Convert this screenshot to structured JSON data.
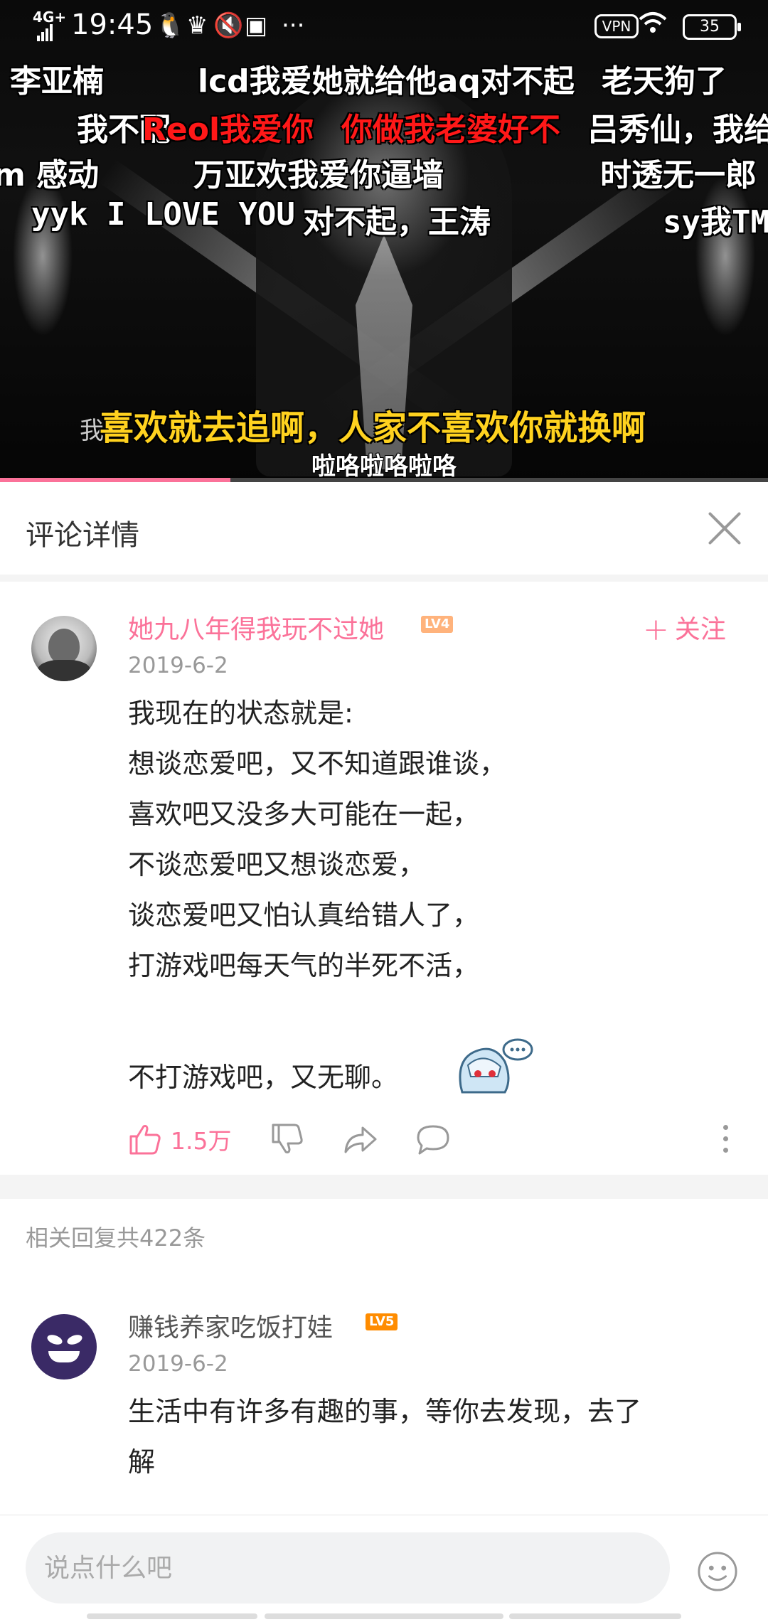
{
  "status_bar": {
    "signal": "4G+",
    "time": "19:45",
    "vpn_label": "VPN",
    "battery": "35"
  },
  "video": {
    "danmaku": {
      "d1": "李亚楠",
      "d2": "lcd我爱她就给他aq对不起",
      "d3": "老天狗了",
      "d4": "我不配",
      "d5": "Reol我爱你",
      "d6": "你做我老婆好不",
      "d7": "吕秀仙，我给",
      "d8": "m 感动",
      "d9": "万亚欢我爱你逼墙",
      "d10": "时透无一郎",
      "d11": "yyk I LOVE YOU",
      "d12": "对不起，王涛",
      "d13": "sy我TM"
    },
    "subtitle_main": "喜欢就去追啊，人家不喜欢你就换啊",
    "subtitle_hidden": "我",
    "subtitle_lyric": "啦咯啦咯啦咯",
    "progress": 0.3
  },
  "header": {
    "title": "评论详情"
  },
  "comment": {
    "user": "她九八年得我玩不过她",
    "level": "LV4",
    "follow_label": "关注",
    "date": "2019-6-2",
    "lines": [
      "我现在的状态就是:",
      "想谈恋爱吧，又不知道跟谁谈，",
      "喜欢吧又没多大可能在一起，",
      "不谈恋爱吧又想谈恋爱，",
      "谈恋爱吧又怕认真给错人了，",
      "打游戏吧每天气的半死不活，",
      "不打游戏吧，又无聊。"
    ],
    "likes": "1.5万"
  },
  "replies_count": "相关回复共422条",
  "reply": {
    "user": "赚钱养家吃饭打娃",
    "level": "LV5",
    "date": "2019-6-2",
    "lines": [
      "生活中有许多有趣的事，等你去发现，去了",
      "解"
    ]
  },
  "input": {
    "placeholder": "说点什么吧"
  },
  "icons": {
    "like": "thumb-up-icon",
    "dislike": "thumb-down-icon",
    "share": "share-icon",
    "reply": "comment-icon",
    "more": "more-vertical-icon",
    "emoji": "emoji-icon",
    "close": "close-icon"
  },
  "colors": {
    "accent": "#fb7299",
    "subtitle_yellow": "#ffd21f",
    "danmaku_red": "#ff1818"
  }
}
